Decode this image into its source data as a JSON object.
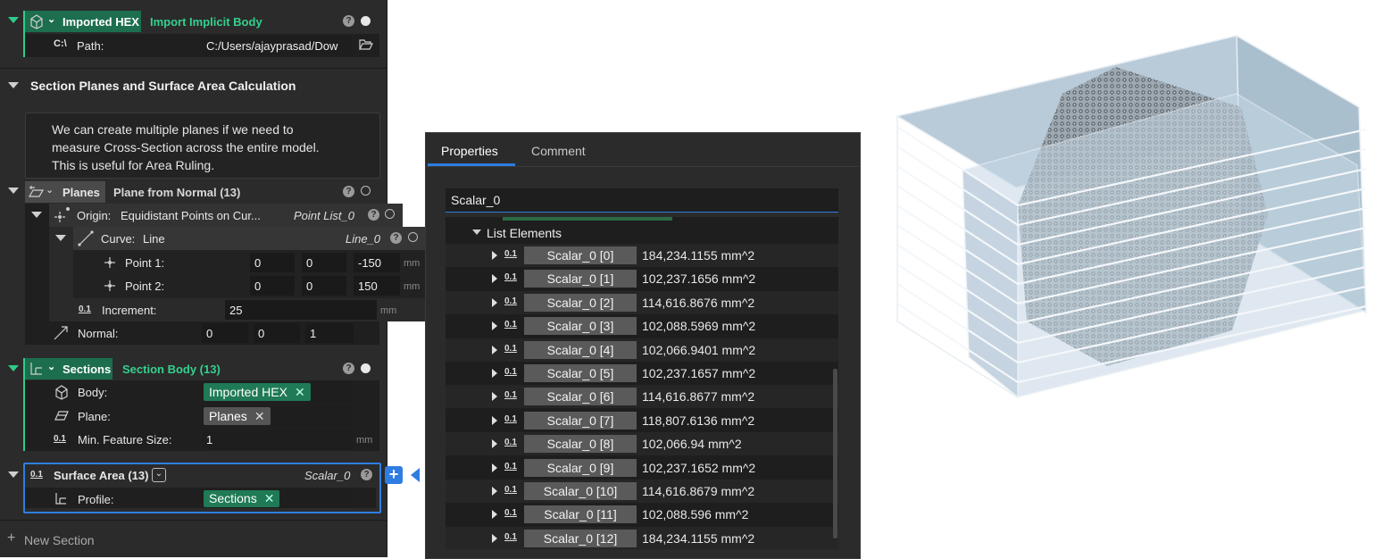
{
  "left_panel": {
    "imported_hex": {
      "head_label": "Imported HEX",
      "title": "Import Implicit Body",
      "path_label": "Path:",
      "path_prefix": "C:\\",
      "path_value": "C:/Users/ajayprasad/Dow"
    },
    "section_header": "Section Planes and Surface Area Calculation",
    "comment_lines": [
      "We can create multiple planes if we need to",
      "measure Cross-Section across the entire model.",
      "This is useful for Area Ruling."
    ],
    "planes": {
      "head_label": "Planes",
      "title": "Plane from Normal (13)",
      "origin": {
        "label": "Origin:",
        "value": "Equidistant Points on Cur...",
        "type": "Point List_0"
      },
      "curve": {
        "label": "Curve:",
        "value": "Line",
        "type": "Line_0"
      },
      "point1": {
        "label": "Point 1:",
        "x": "0",
        "y": "0",
        "z": "-150",
        "unit": "mm"
      },
      "point2": {
        "label": "Point 2:",
        "x": "0",
        "y": "0",
        "z": "150",
        "unit": "mm"
      },
      "increment": {
        "label": "Increment:",
        "value": "25",
        "unit": "mm"
      },
      "normal": {
        "label": "Normal:",
        "x": "0",
        "y": "0",
        "z": "1"
      }
    },
    "sections": {
      "head_label": "Sections",
      "title": "Section Body (13)",
      "body_label": "Body:",
      "body_chip": "Imported HEX",
      "plane_label": "Plane:",
      "plane_chip": "Planes",
      "min_label": "Min. Feature Size:",
      "min_value": "1",
      "min_unit": "mm"
    },
    "surface_area": {
      "title": "Surface Area (13)",
      "type": "Scalar_0",
      "profile_label": "Profile:",
      "profile_chip": "Sections"
    },
    "new_section": "New Section",
    "num_icon_text": "0.1"
  },
  "properties": {
    "tabs": [
      "Properties",
      "Comment"
    ],
    "active_tab": "Properties",
    "search_value": "Scalar_0",
    "list_header": "List Elements",
    "rows": [
      {
        "name": "Scalar_0 [0]",
        "value": "184,234.1155 mm^2"
      },
      {
        "name": "Scalar_0 [1]",
        "value": "102,237.1656 mm^2"
      },
      {
        "name": "Scalar_0 [2]",
        "value": "114,616.8676 mm^2"
      },
      {
        "name": "Scalar_0 [3]",
        "value": "102,088.5969 mm^2"
      },
      {
        "name": "Scalar_0 [4]",
        "value": "102,066.9401 mm^2"
      },
      {
        "name": "Scalar_0 [5]",
        "value": "102,237.1657 mm^2"
      },
      {
        "name": "Scalar_0 [6]",
        "value": "114,616.8677 mm^2"
      },
      {
        "name": "Scalar_0 [7]",
        "value": "118,807.6136 mm^2"
      },
      {
        "name": "Scalar_0 [8]",
        "value": "102,066.94 mm^2"
      },
      {
        "name": "Scalar_0 [9]",
        "value": "102,237.1652 mm^2"
      },
      {
        "name": "Scalar_0 [10]",
        "value": "114,616.8679 mm^2"
      },
      {
        "name": "Scalar_0 [11]",
        "value": "102,088.596 mm^2"
      },
      {
        "name": "Scalar_0 [12]",
        "value": "184,234.1155 mm^2"
      }
    ]
  },
  "colors": {
    "accent_green": "#1c6e4e",
    "accent_blue": "#2f7de1",
    "panel_bg": "#2b2b2b"
  }
}
